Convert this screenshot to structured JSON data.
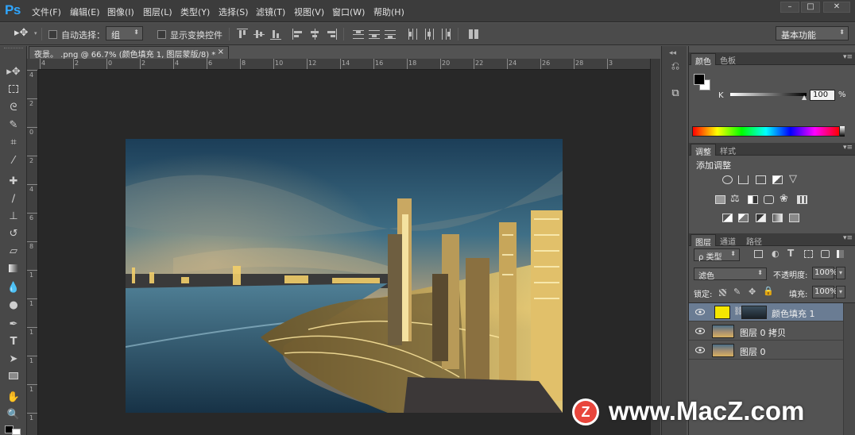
{
  "app": {
    "logo": "Ps",
    "menu": [
      "文件(F)",
      "编辑(E)",
      "图像(I)",
      "图层(L)",
      "类型(Y)",
      "选择(S)",
      "滤镜(T)",
      "视图(V)",
      "窗口(W)",
      "帮助(H)"
    ],
    "window_buttons": [
      "minimize-icon",
      "maximize-icon",
      "close-icon"
    ]
  },
  "options": {
    "auto_select_label": "自动选择：",
    "auto_select_value": "组",
    "show_transform_label": "显示变换控件",
    "workspace": "基本功能"
  },
  "document": {
    "tab_title": "夜景。 .png @ 66.7% (颜色填充 1, 图层蒙版/8) *",
    "ruler_h_ticks": [
      "4",
      "2",
      "0",
      "2",
      "4",
      "6",
      "8",
      "10",
      "12",
      "14",
      "16",
      "18",
      "20",
      "22",
      "24",
      "26",
      "28",
      "3"
    ],
    "ruler_v_ticks": [
      "4",
      "2",
      "0",
      "2",
      "4",
      "6",
      "8",
      "1",
      "1",
      "1",
      "1",
      "1",
      "1"
    ]
  },
  "color_panel": {
    "tabs": [
      "颜色",
      "色板"
    ],
    "channel_label": "K",
    "value": "100",
    "unit": "%"
  },
  "adjustments_panel": {
    "tabs": [
      "调整",
      "样式"
    ],
    "title": "添加调整"
  },
  "layers_panel": {
    "tabs": [
      "图层",
      "通道",
      "路径"
    ],
    "filter_kind": "ρ 类型",
    "blend_mode": "滤色",
    "opacity_label": "不透明度:",
    "opacity_value": "100%",
    "lock_label": "锁定:",
    "fill_label": "填充:",
    "fill_value": "100%",
    "layers": [
      {
        "name": "颜色填充 1",
        "selected": true
      },
      {
        "name": "图层 0 拷贝",
        "selected": false
      },
      {
        "name": "图层 0",
        "selected": false
      }
    ]
  },
  "watermark": {
    "text": "www.MacZ.com",
    "badge": "Z"
  },
  "colors": {
    "accent": "#2fa6ff",
    "fill_swatch": "#f5e600",
    "watermark_badge": "#e8463c"
  }
}
